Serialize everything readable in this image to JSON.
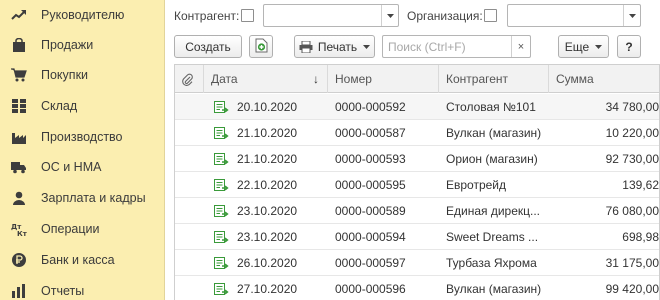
{
  "sidebar": {
    "items": [
      {
        "label": "Руководителю",
        "icon": "trend-chart-icon"
      },
      {
        "label": "Продажи",
        "icon": "shopping-bag-icon"
      },
      {
        "label": "Покупки",
        "icon": "shopping-cart-icon"
      },
      {
        "label": "Склад",
        "icon": "warehouse-grid-icon"
      },
      {
        "label": "Производство",
        "icon": "factory-icon"
      },
      {
        "label": "ОС и НМА",
        "icon": "truck-icon"
      },
      {
        "label": "Зарплата и кадры",
        "icon": "person-icon"
      },
      {
        "label": "Операции",
        "icon": "dt-kt-icon"
      },
      {
        "label": "Банк и касса",
        "icon": "ruble-coin-icon"
      },
      {
        "label": "Отчеты",
        "icon": "report-chart-icon"
      }
    ]
  },
  "filters": {
    "counterparty_label": "Контрагент:",
    "counterparty_value": "",
    "organization_label": "Организация:",
    "organization_value": ""
  },
  "toolbar": {
    "create_label": "Создать",
    "print_label": "Печать",
    "search_placeholder": "Поиск (Ctrl+F)",
    "search_clear": "×",
    "more_label": "Еще",
    "help_label": "?"
  },
  "table": {
    "columns": [
      "Дата",
      "Номер",
      "Контрагент",
      "Сумма"
    ],
    "sort_indicator": "↓",
    "rows": [
      {
        "date": "20.10.2020",
        "number": "0000-000592",
        "counterparty": "Столовая №101",
        "amount": "34 780,00"
      },
      {
        "date": "21.10.2020",
        "number": "0000-000587",
        "counterparty": "Вулкан (магазин)",
        "amount": "10 220,00"
      },
      {
        "date": "21.10.2020",
        "number": "0000-000593",
        "counterparty": "Орион (магазин)",
        "amount": "92 730,00"
      },
      {
        "date": "22.10.2020",
        "number": "0000-000595",
        "counterparty": "Евротрейд",
        "amount": "139,62"
      },
      {
        "date": "23.10.2020",
        "number": "0000-000589",
        "counterparty": "Единая дирекц...",
        "amount": "76 080,00"
      },
      {
        "date": "23.10.2020",
        "number": "0000-000594",
        "counterparty": "Sweet Dreams ...",
        "amount": "698,98"
      },
      {
        "date": "26.10.2020",
        "number": "0000-000597",
        "counterparty": "Турбаза Яхрома",
        "amount": "31 175,00"
      },
      {
        "date": "27.10.2020",
        "number": "0000-000596",
        "counterparty": "Вулкан (магазин)",
        "amount": "99 420,00"
      }
    ]
  },
  "colors": {
    "sidebar_bg": "#fbeeb0",
    "doc_icon_green": "#3a9a3a",
    "accent_yellow": "#f3c51a"
  }
}
